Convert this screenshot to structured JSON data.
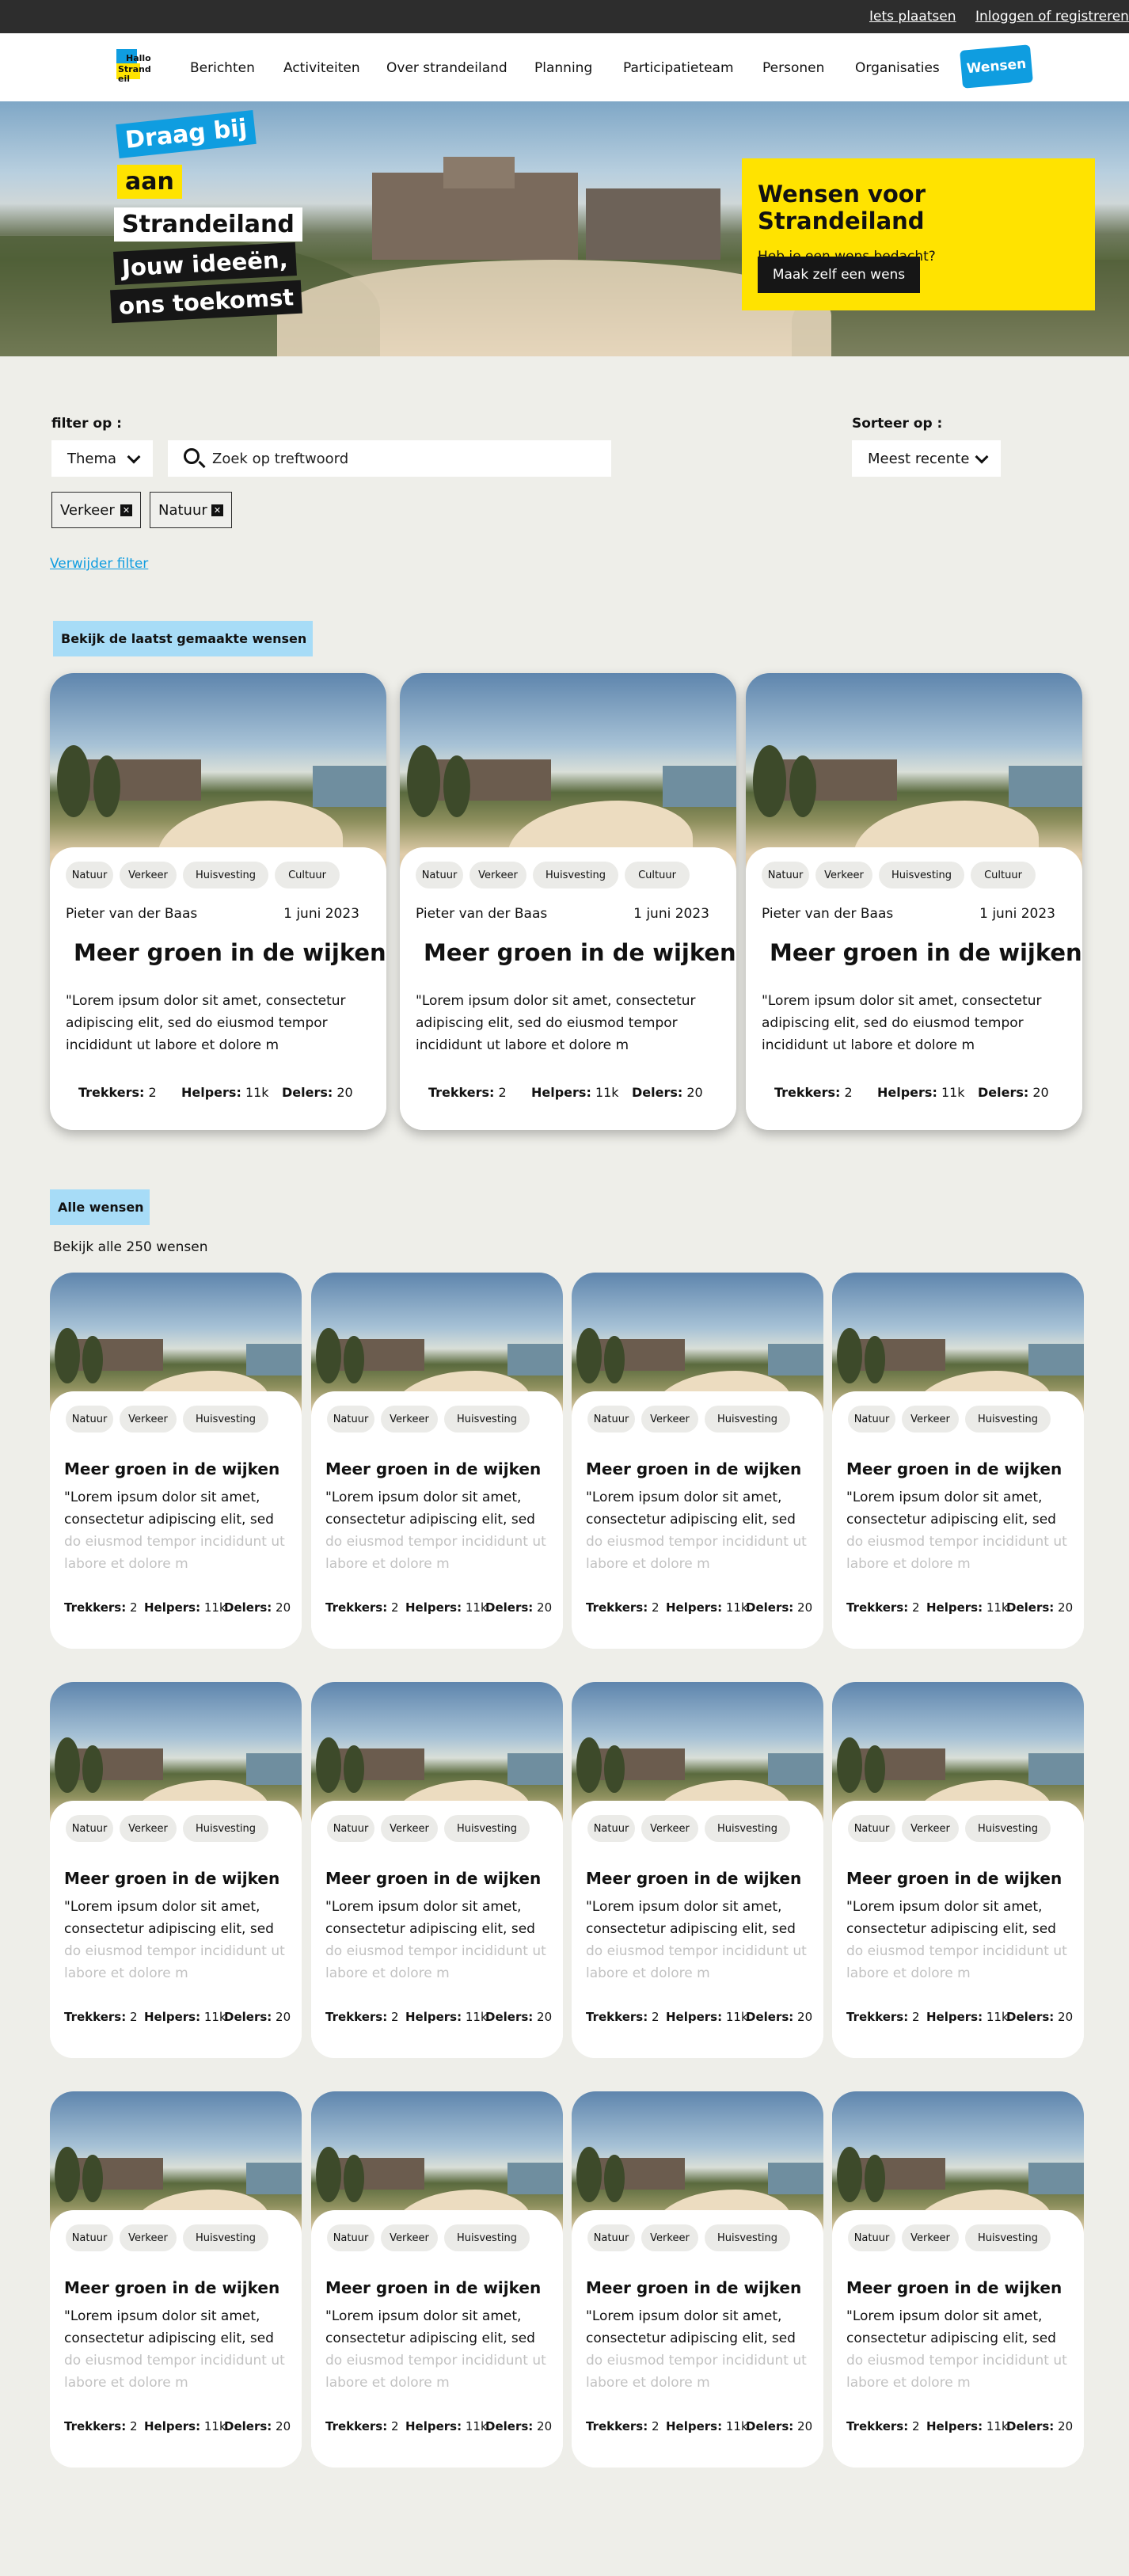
{
  "topbar": {
    "post_link": "Iets plaatsen",
    "login_link": "Inloggen of registreren"
  },
  "logo": {
    "line1": "Hallo",
    "line2": "Strand",
    "line3": "eil"
  },
  "nav": {
    "items": [
      "Berichten",
      "Activiteiten",
      "Over strandeiland",
      "Planning",
      "Participatieteam",
      "Personen",
      "Organisaties"
    ],
    "active": "Wensen"
  },
  "hero": {
    "tag1": "Draag bij",
    "tag2": "aan",
    "tag3": "Strandeiland",
    "tag4": "Jouw ideeën,",
    "tag5": "ons toekomst",
    "promo_title": "Wensen voor Strandeiland",
    "promo_text": "Heb je een wens bedacht?",
    "promo_button": "Maak zelf een wens"
  },
  "filters": {
    "filter_label": "filter op :",
    "theme_select": "Thema",
    "search_placeholder": "Zoek op treftwoord",
    "sort_label": "Sorteer op :",
    "sort_select": "Meest recente",
    "active_chips": [
      "Verkeer",
      "Natuur"
    ],
    "remove_filter": "Verwijder filter"
  },
  "featured": {
    "heading": "Bekijk de  laatst gemaakte  wensen",
    "cards": [
      {
        "tags": [
          "Natuur",
          "Verkeer",
          "Huisvesting",
          "Cultuur"
        ],
        "author": "Pieter van der Baas",
        "date": "1 juni 2023",
        "title": "Meer groen in de wijken",
        "text": "\"Lorem ipsum dolor sit amet, consectetur adipiscing elit, sed do eiusmod tempor incididunt ut labore et dolore m",
        "trekkers_label": "Trekkers:",
        "trekkers": "2",
        "helpers_label": "Helpers:",
        "helpers": "11k",
        "delers_label": "Delers:",
        "delers": "20"
      },
      {
        "tags": [
          "Natuur",
          "Verkeer",
          "Huisvesting",
          "Cultuur"
        ],
        "author": "Pieter van der Baas",
        "date": "1 juni 2023",
        "title": "Meer groen in de wijken",
        "text": "\"Lorem ipsum dolor sit amet, consectetur adipiscing elit, sed do eiusmod tempor incididunt ut labore et dolore m",
        "trekkers_label": "Trekkers:",
        "trekkers": "2",
        "helpers_label": "Helpers:",
        "helpers": "11k",
        "delers_label": "Delers:",
        "delers": "20"
      },
      {
        "tags": [
          "Natuur",
          "Verkeer",
          "Huisvesting",
          "Cultuur"
        ],
        "author": "Pieter van der Baas",
        "date": "1 juni 2023",
        "title": "Meer groen in de wijken",
        "text": "\"Lorem ipsum dolor sit amet, consectetur adipiscing elit, sed do eiusmod tempor incididunt ut labore et dolore m",
        "trekkers_label": "Trekkers:",
        "trekkers": "2",
        "helpers_label": "Helpers:",
        "helpers": "11k",
        "delers_label": "Delers:",
        "delers": "20"
      }
    ]
  },
  "all": {
    "heading": "Alle wensen",
    "subtitle": "Bekijk alle 250 wensen",
    "card": {
      "tags": [
        "Natuur",
        "Verkeer",
        "Huisvesting"
      ],
      "title": "Meer groen in de wijken",
      "text_visible": "\"Lorem ipsum dolor sit amet, consectetur adipiscing elit, sed",
      "text_faded": "do eiusmod tempor incididunt ut labore et dolore m",
      "trekkers_label": "Trekkers:",
      "trekkers": "2",
      "helpers_label": "Helpers:",
      "helpers": "11k",
      "delers_label": "Delers:",
      "delers": "20"
    }
  }
}
